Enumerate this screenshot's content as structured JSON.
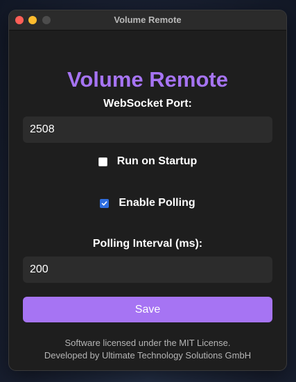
{
  "window": {
    "title": "Volume Remote"
  },
  "app": {
    "heading": "Volume Remote",
    "accent_color": "#a674f3"
  },
  "websocket": {
    "label": "WebSocket Port:",
    "value": "2508"
  },
  "startup": {
    "label": "Run on Startup",
    "checked": false
  },
  "polling": {
    "label": "Enable Polling",
    "checked": true
  },
  "interval": {
    "label": "Polling Interval (ms):",
    "value": "200"
  },
  "save": {
    "label": "Save"
  },
  "footer": {
    "line1": "Software licensed under the MIT License.",
    "line2": "Developed by Ultimate Technology Solutions GmbH"
  }
}
